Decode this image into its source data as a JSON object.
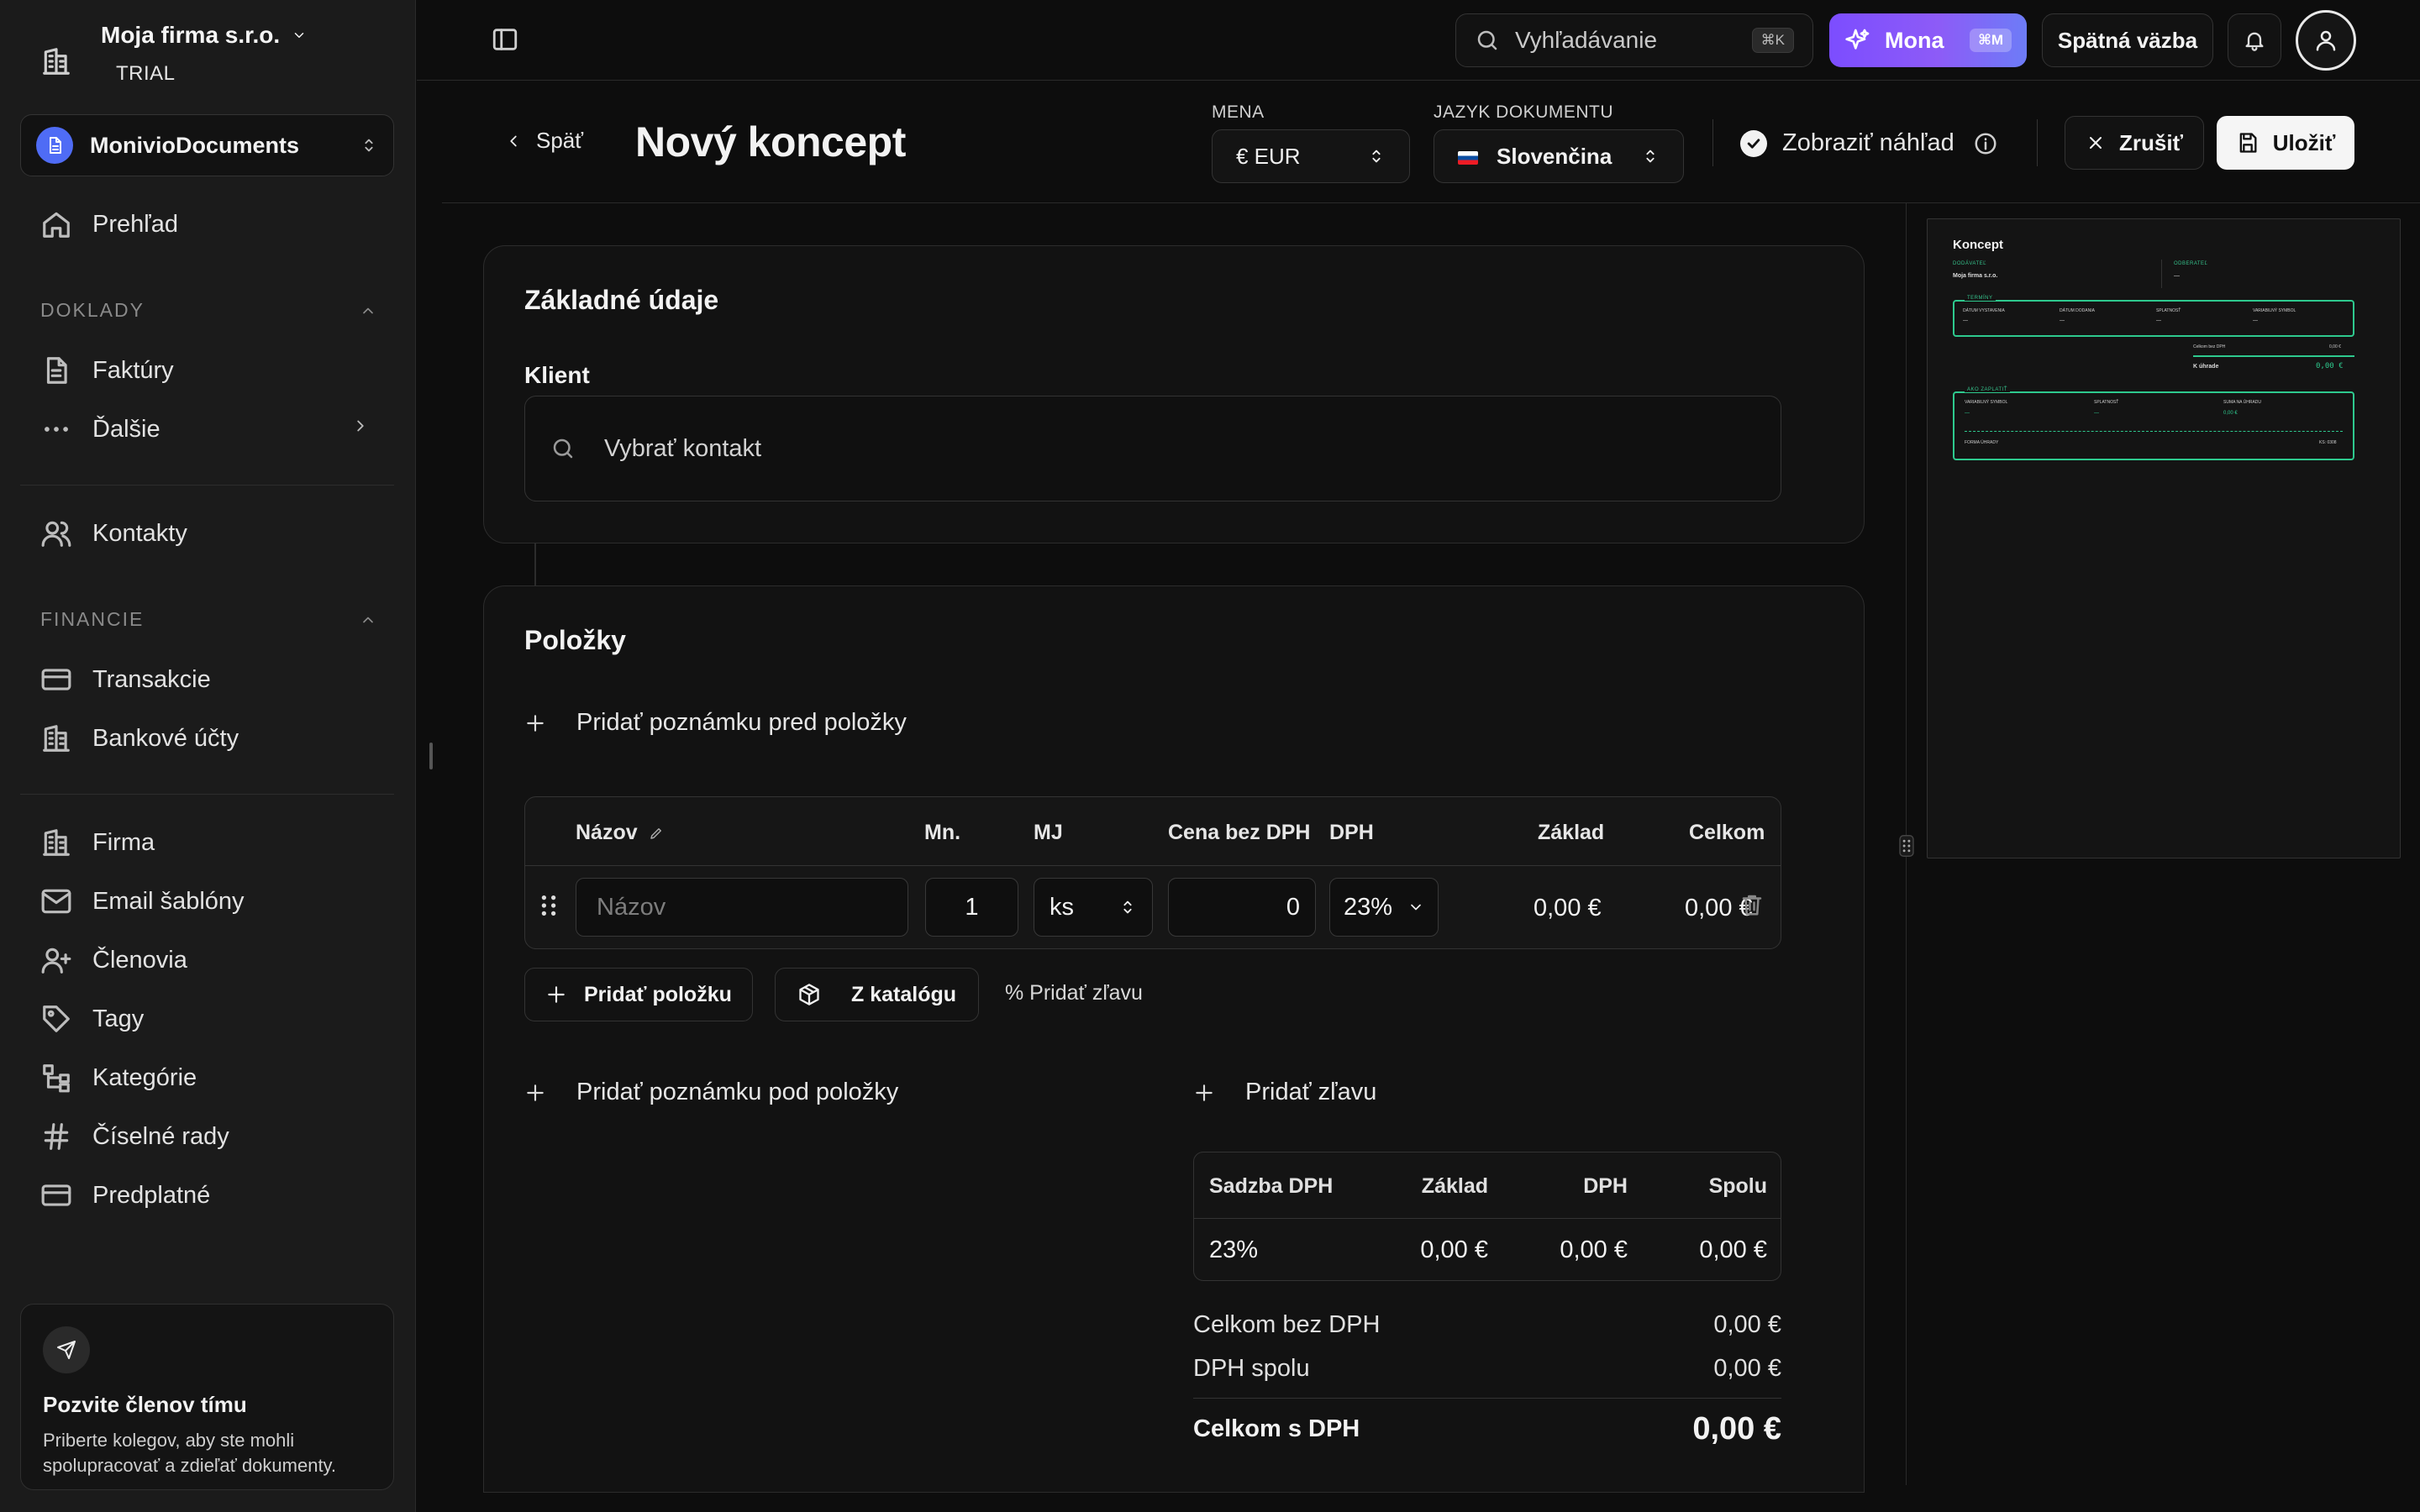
{
  "sidebar": {
    "company_name": "Moja firma s.r.o.",
    "company_plan": "TRIAL",
    "workspace_name": "MonivioDocuments",
    "overview": "Prehľad",
    "section_doklady": "DOKLADY",
    "invoices": "Faktúry",
    "more": "Ďalšie",
    "contacts": "Kontakty",
    "section_financie": "FINANCIE",
    "transactions": "Transakcie",
    "bank_accounts": "Bankové účty",
    "company": "Firma",
    "email_templates": "Email šablóny",
    "members": "Členovia",
    "tags": "Tagy",
    "categories": "Kategórie",
    "number_series": "Číselné rady",
    "subscription": "Predplatné",
    "invite_title": "Pozvite členov tímu",
    "invite_desc": "Priberte kolegov, aby ste mohli spolupracovať a zdieľať dokumenty."
  },
  "topbar": {
    "search_placeholder": "Vyhľadávanie",
    "search_shortcut": "⌘K",
    "mona_label": "Mona",
    "mona_shortcut": "⌘M",
    "feedback_label": "Spätná väzba"
  },
  "header": {
    "back_label": "Späť",
    "title": "Nový koncept",
    "currency_label": "MENA",
    "currency_value": "€ EUR",
    "language_label": "JAZYK DOKUMENTU",
    "language_value": "Slovenčina",
    "preview_toggle_label": "Zobraziť náhľad",
    "preview_toggle_checked": true,
    "cancel_label": "Zrušiť",
    "save_label": "Uložiť"
  },
  "basic": {
    "title": "Základné údaje",
    "client_label": "Klient",
    "client_placeholder": "Vybrať kontakt"
  },
  "items": {
    "title": "Položky",
    "add_note_before": "Pridať poznámku pred položky",
    "columns": {
      "name": "Názov",
      "qty": "Mn.",
      "unit": "MJ",
      "price": "Cena bez DPH",
      "vat": "DPH",
      "base": "Základ",
      "total": "Celkom"
    },
    "rows": [
      {
        "name_placeholder": "Názov",
        "qty": "1",
        "unit": "ks",
        "price": "0",
        "vat": "23%",
        "base": "0,00 €",
        "total": "0,00 €"
      }
    ],
    "add_item": "Pridať položku",
    "from_catalog": "Z katalógu",
    "add_discount_inline": "% Pridať zľavu",
    "add_note_after": "Pridať poznámku pod položky",
    "add_discount": "Pridať zľavu"
  },
  "vat_summary": {
    "headers": [
      "Sadzba DPH",
      "Základ",
      "DPH",
      "Spolu"
    ],
    "rows": [
      [
        "23%",
        "0,00 €",
        "0,00 €",
        "0,00 €"
      ]
    ]
  },
  "totals": {
    "without_vat_label": "Celkom bez DPH",
    "without_vat_value": "0,00 €",
    "vat_total_label": "DPH spolu",
    "vat_total_value": "0,00 €",
    "with_vat_label": "Celkom s DPH",
    "with_vat_value": "0,00 €"
  },
  "preview": {
    "doc_title": "Koncept",
    "supplier_label": "DODÁVATEĽ",
    "supplier_name": "Moja firma s.r.o.",
    "customer_label": "ODBERATEĽ",
    "customer_value": "—",
    "terms_label": "TERMÍNY",
    "issue_date_label": "DÁTUM VYSTAVENIA",
    "delivery_date_label": "DÁTUM DODANIA",
    "due_label": "SPLATNOSŤ",
    "vs_label": "VARIABILNÝ SYMBOL",
    "sum_without_vat": "Celkom bez DPH",
    "sum_without_vat_value": "0,00 €",
    "to_pay_label": "K úhrade",
    "to_pay_value": "0,00 €",
    "how_to_pay_label": "AKO ZAPLATIŤ",
    "pay_vs_label": "VARIABILNÝ SYMBOL",
    "pay_due_label": "SPLATNOSŤ",
    "pay_amount_label": "SUMA NA ÚHRADU",
    "pay_amount_value": "0,00 €",
    "payment_form_label": "FORMA ÚHRADY",
    "ks_label": "KS: 0308",
    "dash": "—"
  },
  "colors": {
    "accent_purple": "#7c4dff",
    "workspace_blue": "#4f6cf5",
    "preview_green": "#2ec98e"
  }
}
